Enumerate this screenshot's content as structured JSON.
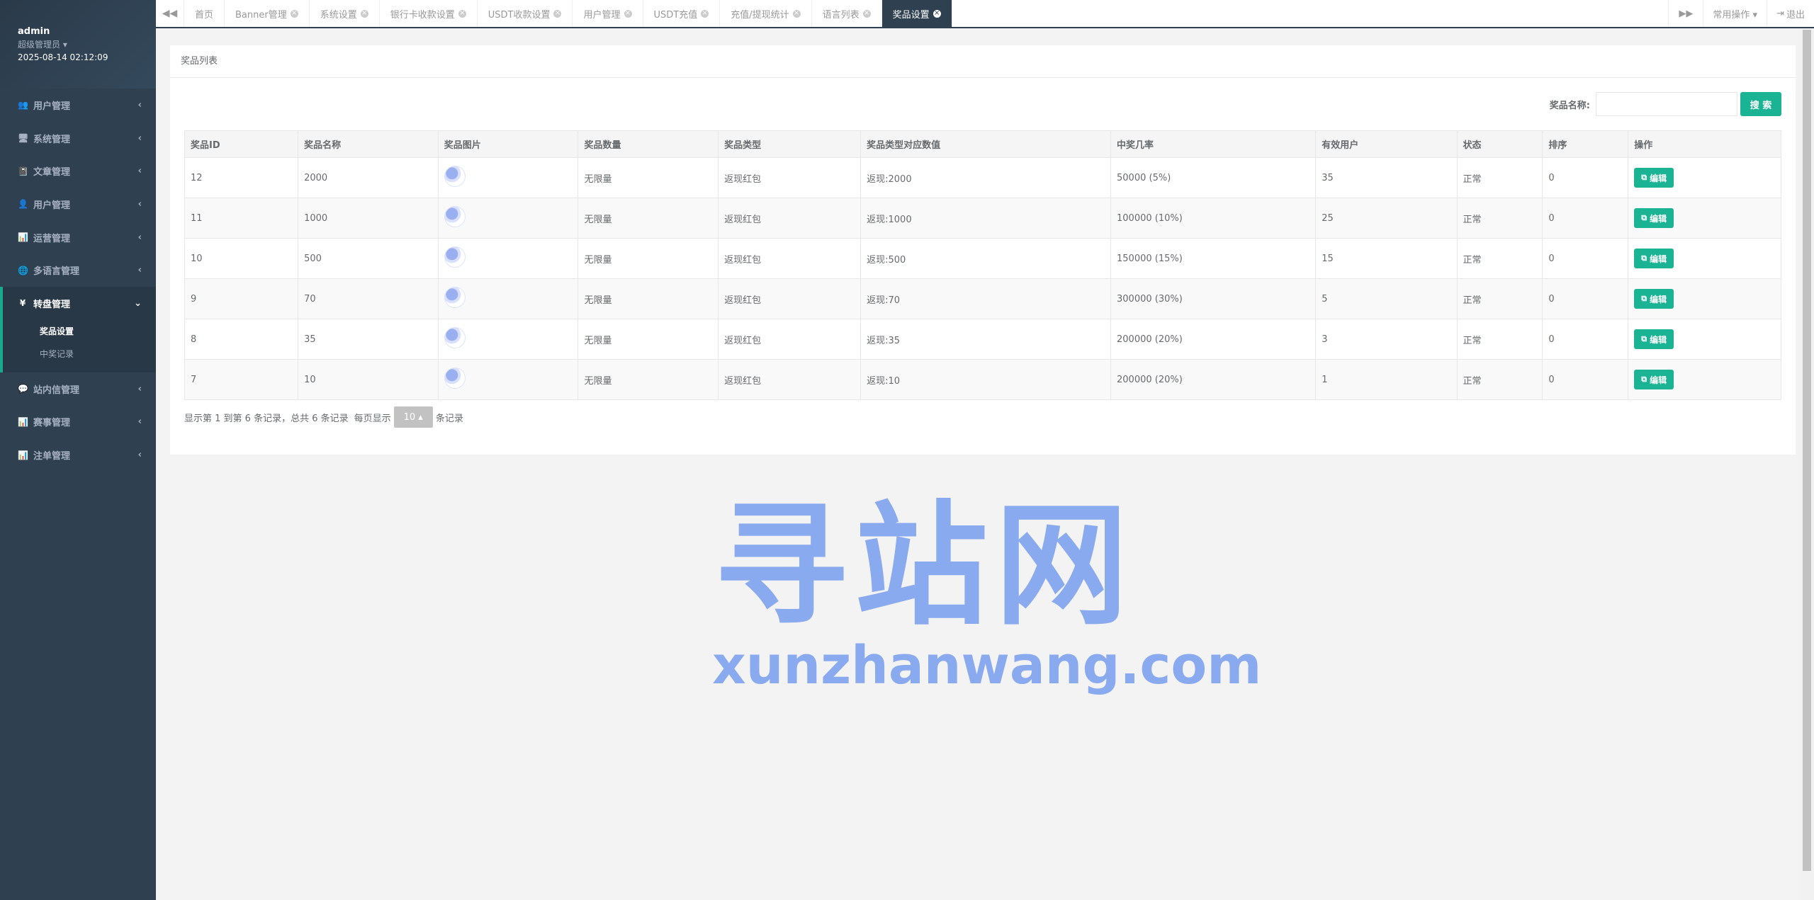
{
  "profile": {
    "name": "admin",
    "role": "超级管理员 ▾",
    "time": "2025-08-14 02:12:09"
  },
  "sidebar": {
    "items": [
      {
        "label": "用户管理",
        "icon": "users-icon",
        "glyph": "👥"
      },
      {
        "label": "系统管理",
        "icon": "monitor-icon",
        "glyph": "🖥"
      },
      {
        "label": "文章管理",
        "icon": "book-icon",
        "glyph": "📓"
      },
      {
        "label": "用户管理",
        "icon": "user-icon",
        "glyph": "👤"
      },
      {
        "label": "运营管理",
        "icon": "bar-chart-icon",
        "glyph": "📊"
      },
      {
        "label": "多语言管理",
        "icon": "globe-icon",
        "glyph": "🌐"
      }
    ],
    "active": {
      "label": "转盘管理",
      "glyph": "¥",
      "subs": [
        "奖品设置",
        "中奖记录"
      ]
    },
    "items_after": [
      {
        "label": "站内信管理",
        "icon": "comment-icon",
        "glyph": "💬"
      },
      {
        "label": "赛事管理",
        "icon": "bar-chart-icon",
        "glyph": "📊"
      },
      {
        "label": "注单管理",
        "icon": "bar-chart-icon",
        "glyph": "📊"
      }
    ]
  },
  "tabs": {
    "list": [
      "首页",
      "Banner管理",
      "系统设置",
      "银行卡收款设置",
      "USDT收款设置",
      "用户管理",
      "USDT充值",
      "充值/提现统计",
      "语言列表",
      "奖品设置"
    ],
    "active_index": 9,
    "right": {
      "common_ops": "常用操作 ▾",
      "logout": "退出"
    }
  },
  "panel": {
    "title": "奖品列表",
    "search_label": "奖品名称:",
    "search_btn": "搜 索",
    "columns": [
      "奖品ID",
      "奖品名称",
      "奖品图片",
      "奖品数量",
      "奖品类型",
      "奖品类型对应数值",
      "中奖几率",
      "有效用户",
      "状态",
      "排序",
      "操作"
    ],
    "rows": [
      [
        "12",
        "2000",
        "",
        "无限量",
        "返现红包",
        "返现:2000",
        "50000 (5%)",
        "35",
        "正常",
        "0"
      ],
      [
        "11",
        "1000",
        "",
        "无限量",
        "返现红包",
        "返现:1000",
        "100000 (10%)",
        "25",
        "正常",
        "0"
      ],
      [
        "10",
        "500",
        "",
        "无限量",
        "返现红包",
        "返现:500",
        "150000 (15%)",
        "15",
        "正常",
        "0"
      ],
      [
        "9",
        "70",
        "",
        "无限量",
        "返现红包",
        "返现:70",
        "300000 (30%)",
        "5",
        "正常",
        "0"
      ],
      [
        "8",
        "35",
        "",
        "无限量",
        "返现红包",
        "返现:35",
        "200000 (20%)",
        "3",
        "正常",
        "0"
      ],
      [
        "7",
        "10",
        "",
        "无限量",
        "返现红包",
        "返现:10",
        "200000 (20%)",
        "1",
        "正常",
        "0"
      ]
    ],
    "edit_label": "编辑",
    "pager_text": "显示第 1 到第 6 条记录，总共 6 条记录",
    "per_page_label": "每页显示",
    "per_page_value": "10 ▴",
    "per_page_suffix": "条记录"
  },
  "watermark": {
    "cn": "寻站网",
    "en": "xunzhanwang.com"
  },
  "colors": {
    "sidebar": "#2f4050",
    "accent": "#1ab394",
    "watermark": "#8aaaf0"
  }
}
